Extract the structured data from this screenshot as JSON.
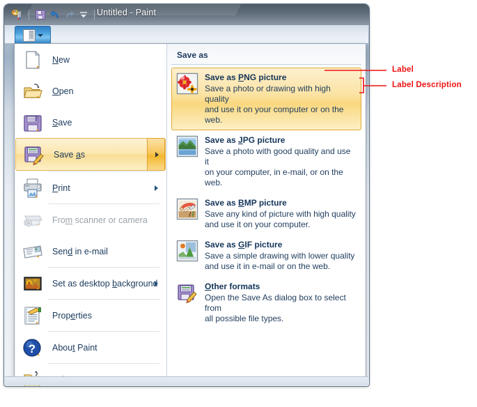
{
  "window": {
    "title": "Untitled - Paint",
    "quick_access": [
      {
        "name": "paint-app-icon",
        "label": "Paint"
      },
      {
        "name": "save-icon",
        "label": "Save"
      },
      {
        "name": "undo-icon",
        "label": "Undo"
      },
      {
        "name": "redo-icon",
        "label": "Redo"
      },
      {
        "name": "customize-quick-access-icon",
        "label": "Customize Quick Access Toolbar"
      }
    ]
  },
  "ribbon": {
    "menu_button": {
      "name": "paint-menu-button",
      "label": "Paint menu"
    }
  },
  "menu": {
    "items": [
      {
        "label": "New",
        "accel": "N",
        "icon": "new-document-icon",
        "disabled": false,
        "submenu": false,
        "selected": false,
        "separator_after": false
      },
      {
        "label": "Open",
        "accel": "O",
        "icon": "open-folder-icon",
        "disabled": false,
        "submenu": false,
        "selected": false,
        "separator_after": false
      },
      {
        "label": "Save",
        "accel": "S",
        "icon": "floppy-disk-icon",
        "disabled": false,
        "submenu": false,
        "selected": false,
        "separator_after": false
      },
      {
        "label": "Save as",
        "accel": "a",
        "icon": "floppy-pencil-icon",
        "disabled": false,
        "submenu": true,
        "selected": true,
        "separator_after": true
      },
      {
        "label": "Print",
        "accel": "P",
        "icon": "printer-icon",
        "disabled": false,
        "submenu": true,
        "selected": false,
        "separator_after": true
      },
      {
        "label": "From scanner or camera",
        "accel": "m",
        "icon": "scanner-camera-icon",
        "disabled": true,
        "submenu": false,
        "selected": false,
        "separator_after": false
      },
      {
        "label": "Send in e-mail",
        "accel": "d",
        "icon": "email-icon",
        "disabled": false,
        "submenu": false,
        "selected": false,
        "separator_after": true
      },
      {
        "label": "Set as desktop background",
        "accel": "b",
        "icon": "desktop-background-icon",
        "disabled": false,
        "submenu": true,
        "selected": false,
        "separator_after": true
      },
      {
        "label": "Properties",
        "accel": "e",
        "icon": "properties-icon",
        "disabled": false,
        "submenu": false,
        "selected": false,
        "separator_after": true
      },
      {
        "label": "About Paint",
        "accel": "t",
        "icon": "about-help-icon",
        "disabled": false,
        "submenu": false,
        "selected": false,
        "separator_after": true
      },
      {
        "label": "Exit",
        "accel": "x",
        "icon": "exit-folder-icon",
        "disabled": false,
        "submenu": false,
        "selected": false,
        "separator_after": false
      }
    ]
  },
  "submenu": {
    "header": "Save as",
    "items": [
      {
        "title": "Save as PNG picture",
        "accel": "P",
        "description": "Save a photo or drawing with high quality\nand use it on your computer or on the web.",
        "icon": "png-flower-icon",
        "selected": true
      },
      {
        "title": "Save as JPG picture",
        "accel": "J",
        "description": "Save a photo with good quality and use it\non your computer, in e-mail, or on the web.",
        "icon": "jpg-photo-icon",
        "selected": false
      },
      {
        "title": "Save as BMP picture",
        "accel": "B",
        "description": "Save any kind of picture with high quality\nand use it on your computer.",
        "icon": "bmp-paint-icon",
        "selected": false
      },
      {
        "title": "Save as GIF picture",
        "accel": "G",
        "description": "Save a simple drawing with lower quality\nand use it in e-mail or on the web.",
        "icon": "gif-drawing-icon",
        "selected": false
      },
      {
        "title": "Other formats",
        "accel": "O",
        "description": "Open the Save As dialog box to select from\nall possible file types.",
        "icon": "other-formats-icon",
        "selected": false
      }
    ]
  },
  "annotations": [
    {
      "text": "Label",
      "target": "Save as PNG picture title"
    },
    {
      "text": "Label Description",
      "target": "Save as PNG picture description"
    }
  ],
  "colors": {
    "annotation": "#ee1111",
    "highlight_border": "#e0a93a",
    "menu_text": "#1b3a5c",
    "title_text": "#ffffff"
  }
}
